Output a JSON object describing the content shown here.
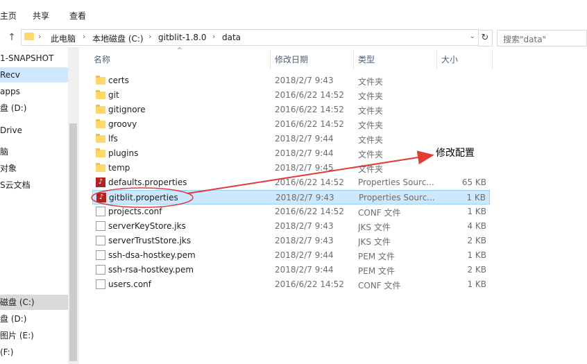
{
  "ribbon": {
    "tabs": [
      "主页",
      "共享",
      "查看"
    ]
  },
  "address": {
    "crumbs": [
      "此电脑",
      "本地磁盘 (C:)",
      "gitblit-1.8.0",
      "data"
    ],
    "search_placeholder": "搜索\"data\""
  },
  "nav": {
    "items": [
      "1-SNAPSHOT",
      "Recv",
      "apps",
      "盘 (D:)",
      "Drive",
      "脑",
      "对象",
      "S云文档",
      "",
      "",
      "",
      "",
      "",
      "",
      "磁盘 (C:)",
      "盘 (D:)",
      "图片 (E:)",
      "(F:)"
    ]
  },
  "columns": {
    "name": "名称",
    "date": "修改日期",
    "type": "类型",
    "size": "大小"
  },
  "files": [
    {
      "name": "certs",
      "date": "2018/2/7 9:43",
      "type": "文件夹",
      "size": "",
      "icon": "folder"
    },
    {
      "name": "git",
      "date": "2016/6/22 14:52",
      "type": "文件夹",
      "size": "",
      "icon": "folder"
    },
    {
      "name": "gitignore",
      "date": "2016/6/22 14:52",
      "type": "文件夹",
      "size": "",
      "icon": "folder"
    },
    {
      "name": "groovy",
      "date": "2016/6/22 14:52",
      "type": "文件夹",
      "size": "",
      "icon": "folder"
    },
    {
      "name": "lfs",
      "date": "2018/2/7 9:44",
      "type": "文件夹",
      "size": "",
      "icon": "folder"
    },
    {
      "name": "plugins",
      "date": "2018/2/7 9:44",
      "type": "文件夹",
      "size": "",
      "icon": "folder"
    },
    {
      "name": "temp",
      "date": "2018/2/7 9:45",
      "type": "文件夹",
      "size": "",
      "icon": "folder"
    },
    {
      "name": "defaults.properties",
      "date": "2016/6/22 14:52",
      "type": "Properties Sourc...",
      "size": "65 KB",
      "icon": "properties"
    },
    {
      "name": "gitblit.properties",
      "date": "2018/2/7 9:43",
      "type": "Properties Sourc...",
      "size": "1 KB",
      "icon": "properties"
    },
    {
      "name": "projects.conf",
      "date": "2016/6/22 14:52",
      "type": "CONF 文件",
      "size": "1 KB",
      "icon": "file"
    },
    {
      "name": "serverKeyStore.jks",
      "date": "2018/2/7 9:43",
      "type": "JKS 文件",
      "size": "4 KB",
      "icon": "file"
    },
    {
      "name": "serverTrustStore.jks",
      "date": "2018/2/7 9:43",
      "type": "JKS 文件",
      "size": "2 KB",
      "icon": "file"
    },
    {
      "name": "ssh-dsa-hostkey.pem",
      "date": "2018/2/7 9:44",
      "type": "PEM 文件",
      "size": "1 KB",
      "icon": "file"
    },
    {
      "name": "ssh-rsa-hostkey.pem",
      "date": "2018/2/7 9:44",
      "type": "PEM 文件",
      "size": "2 KB",
      "icon": "file"
    },
    {
      "name": "users.conf",
      "date": "2016/6/22 14:52",
      "type": "CONF 文件",
      "size": "1 KB",
      "icon": "file"
    }
  ],
  "selected_file": "gitblit.properties",
  "annotation": {
    "text": "修改配置",
    "color": "#e53935"
  }
}
